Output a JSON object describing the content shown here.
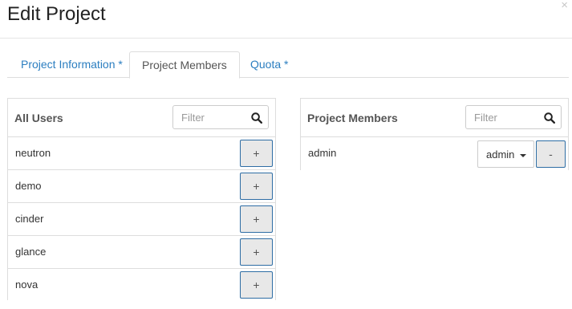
{
  "modal": {
    "title": "Edit Project",
    "close_label": "×"
  },
  "tabs": [
    {
      "label": "Project Information *",
      "active": false
    },
    {
      "label": "Project Members",
      "active": true
    },
    {
      "label": "Quota *",
      "active": false
    }
  ],
  "all_users": {
    "title": "All Users",
    "filter_placeholder": "Filter",
    "add_label": "+",
    "users": [
      "neutron",
      "demo",
      "cinder",
      "glance",
      "nova"
    ]
  },
  "project_members": {
    "title": "Project Members",
    "filter_placeholder": "Filter",
    "remove_label": "-",
    "members": [
      {
        "name": "admin",
        "role": "admin"
      }
    ]
  },
  "icons": {
    "search": "search-icon",
    "caret": "caret-down-icon",
    "close": "close-icon"
  },
  "colors": {
    "tab_link": "#2b7ec0",
    "button_border": "#2e6da4",
    "button_bg": "#e8e8e8"
  }
}
